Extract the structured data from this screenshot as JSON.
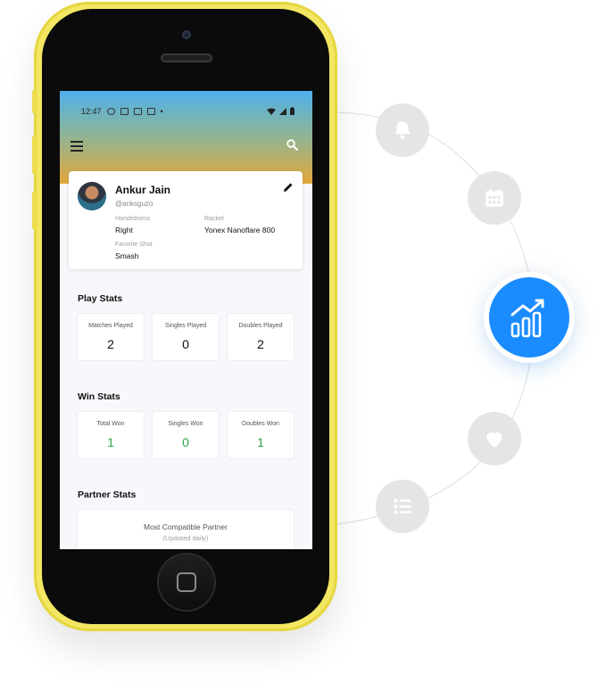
{
  "status_bar": {
    "time": "12:47"
  },
  "profile": {
    "name": "Ankur Jain",
    "handle": "@anksguzo",
    "handedness_label": "Handedness",
    "handedness_value": "Right",
    "racket_label": "Racket",
    "racket_value": "Yonex Nanoflare 800",
    "favorite_shot_label": "Favorite Shot",
    "favorite_shot_value": "Smash"
  },
  "play_stats": {
    "title": "Play Stats",
    "items": [
      {
        "label": "Matches Played",
        "value": "2"
      },
      {
        "label": "Singles Played",
        "value": "0"
      },
      {
        "label": "Doubles Played",
        "value": "2"
      }
    ]
  },
  "win_stats": {
    "title": "Win Stats",
    "items": [
      {
        "label": "Total Won",
        "value": "1"
      },
      {
        "label": "Singles Won",
        "value": "0"
      },
      {
        "label": "Doubles Won",
        "value": "1"
      }
    ]
  },
  "partner_stats": {
    "title": "Partner Stats",
    "card_title": "Most Compatible Partner",
    "card_subtitle": "(Updated daily)"
  },
  "orbit_icons": [
    "bell-icon",
    "calendar-icon",
    "analytics-chart-icon",
    "heart-icon",
    "list-icon"
  ],
  "colors": {
    "accent_blue": "#1a8cff",
    "win_green": "#2aa54a",
    "phone_yellow": "#f3e663"
  }
}
